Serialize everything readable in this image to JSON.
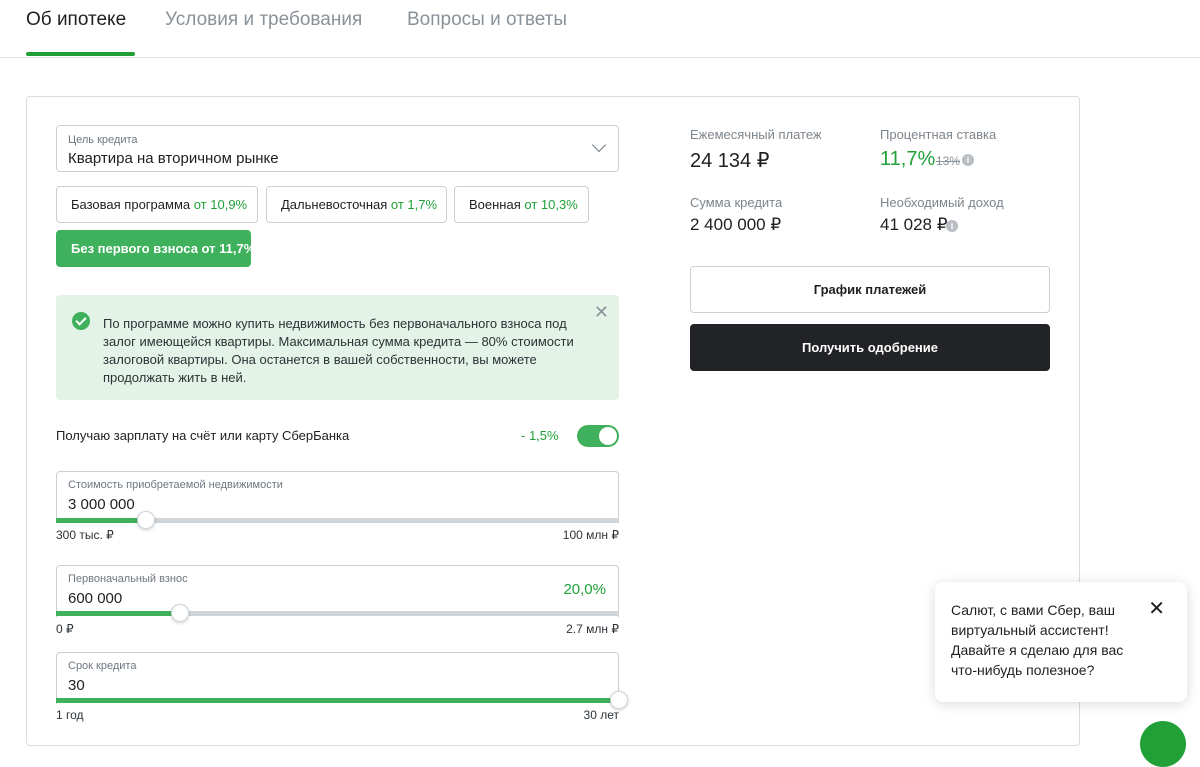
{
  "tabs": [
    "Об ипотеке",
    "Условия и требования",
    "Вопросы и ответы"
  ],
  "loan_purpose": {
    "label": "Цель кредита",
    "value": "Квартира на вторичном рынке"
  },
  "programs": [
    {
      "name": "Базовая программа",
      "rate": "от 10,9%"
    },
    {
      "name": "Дальневосточная",
      "rate": "от 1,7%"
    },
    {
      "name": "Военная",
      "rate": "от 10,3%"
    },
    {
      "name": "Без первого взноса",
      "rate": "от 11,7%",
      "selected": true
    }
  ],
  "info_text": "По программе можно купить недвижимость без первоначального взноса под залог имеющейся квартиры. Максимальная сумма кредита — 80% стоимости залоговой квартиры. Она останется в вашей собственности, вы можете продолжать жить в ней.",
  "salary": {
    "label": "Получаю зарплату на счёт или карту СберБанка",
    "discount": "- 1,5%",
    "enabled": true
  },
  "sliders": {
    "property": {
      "label": "Стоимость приобретаемой недвижимости",
      "value": "3 000 000",
      "min": "300 тыс. ₽",
      "max": "100 млн ₽",
      "fraction": 0.16
    },
    "down": {
      "label": "Первоначальный взнос",
      "value": "600 000",
      "percent": "20,0%",
      "min": "0 ₽",
      "max": "2.7 млн ₽",
      "fraction": 0.22
    },
    "term": {
      "label": "Срок кредита",
      "value": "30",
      "min": "1 год",
      "max": "30 лет",
      "fraction": 1.0
    }
  },
  "summary": {
    "monthly_label": "Ежемесячный платеж",
    "monthly": "24 134 ₽",
    "rate_label": "Процентная ставка",
    "rate": "11,7%",
    "old_rate": "13%",
    "amount_label": "Сумма кредита",
    "amount": "2 400 000 ₽",
    "income_label": "Необходимый доход",
    "income": "41 028 ₽"
  },
  "buttons": {
    "schedule": "График платежей",
    "approval": "Получить одобрение"
  },
  "chat": {
    "message": "Салют, с вами Сбер, ваш виртуальный ассистент! Давайте я сделаю для вас что-нибудь полезное?"
  },
  "colors": {
    "accent": "#21a038",
    "button_dark": "#222326",
    "info_bg": "#e4f3e8"
  },
  "icons": {
    "info_check": "check-circle-icon",
    "close": "close-icon",
    "dropdown": "chevron-down-icon",
    "hint": "info-icon"
  }
}
